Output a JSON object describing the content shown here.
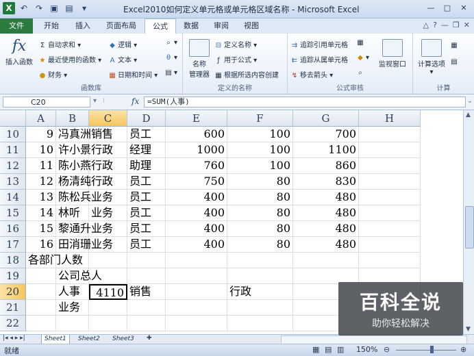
{
  "window": {
    "title": "Excel2010如何定义单元格或单元格区域名称 - Microsoft Excel",
    "app_logo": "X",
    "controls": [
      "—",
      "□",
      "✕"
    ]
  },
  "tabs": [
    {
      "label": "文件"
    },
    {
      "label": "开始"
    },
    {
      "label": "插入"
    },
    {
      "label": "页面布局"
    },
    {
      "label": "公式"
    },
    {
      "label": "数据"
    },
    {
      "label": "审阅"
    },
    {
      "label": "视图"
    }
  ],
  "ribbon": {
    "function_library": {
      "insert_function": "插入函数",
      "autosum": "自动求和",
      "recent": "最近使用的函数",
      "financial": "财务",
      "logical": "逻辑",
      "text": "文本",
      "datetime": "日期和时间",
      "label": "函数库"
    },
    "defined_names": {
      "name_manager_1": "名称",
      "name_manager_2": "管理器",
      "define_name": "定义名称",
      "use_in_formula": "用于公式",
      "create_from_selection": "根据所选内容创建",
      "label": "定义的名称"
    },
    "formula_auditing": {
      "trace_precedents": "追踪引用单元格",
      "trace_dependents": "追踪从属单元格",
      "remove_arrows": "移去箭头",
      "watch_window": "监视窗口",
      "label": "公式审核"
    },
    "calculation": {
      "calc_options": "计算选项",
      "label": "计算"
    }
  },
  "formula_bar": {
    "name_box": "C20",
    "fx": "fx",
    "formula": "=SUM(人事)"
  },
  "columns": [
    "A",
    "B",
    "C",
    "D",
    "E",
    "F",
    "G",
    "H"
  ],
  "rows": [
    {
      "num": "10",
      "cells": [
        "9",
        "冯真洲",
        "销售",
        "员工",
        "600",
        "100",
        "700",
        ""
      ]
    },
    {
      "num": "11",
      "cells": [
        "10",
        "许小景",
        "行政",
        "经理",
        "1000",
        "100",
        "1100",
        ""
      ]
    },
    {
      "num": "12",
      "cells": [
        "11",
        "陈小燕",
        "行政",
        "助理",
        "760",
        "100",
        "860",
        ""
      ]
    },
    {
      "num": "13",
      "cells": [
        "12",
        "杨清纯",
        "行政",
        "员工",
        "750",
        "80",
        "830",
        ""
      ]
    },
    {
      "num": "14",
      "cells": [
        "13",
        "陈松兵",
        "业务",
        "员工",
        "400",
        "80",
        "480",
        ""
      ]
    },
    {
      "num": "15",
      "cells": [
        "14",
        "林听",
        "业务",
        "员工",
        "400",
        "80",
        "480",
        ""
      ]
    },
    {
      "num": "16",
      "cells": [
        "15",
        "黎通升",
        "业务",
        "员工",
        "400",
        "80",
        "480",
        ""
      ]
    },
    {
      "num": "17",
      "cells": [
        "16",
        "田消珊",
        "业务",
        "员工",
        "400",
        "80",
        "480",
        ""
      ]
    },
    {
      "num": "18",
      "cells": [
        "各部门人数",
        "",
        "",
        "",
        "",
        "",
        "",
        ""
      ]
    },
    {
      "num": "19",
      "cells": [
        "",
        "公司总人",
        "",
        "",
        "",
        "",
        "",
        ""
      ]
    },
    {
      "num": "20",
      "cells": [
        "",
        "人事",
        "4110",
        "销售",
        "",
        "行政",
        "",
        ""
      ]
    },
    {
      "num": "21",
      "cells": [
        "",
        "业务",
        "",
        "",
        "",
        "",
        "",
        ""
      ]
    },
    {
      "num": "22",
      "cells": [
        "",
        "",
        "",
        "",
        "",
        "",
        "",
        ""
      ]
    }
  ],
  "sheets": [
    "Sheet1",
    "Sheet2",
    "Sheet3"
  ],
  "status": {
    "ready": "就绪",
    "zoom": "150%"
  },
  "watermark": {
    "title": "百科全说",
    "subtitle": "助你轻松解决"
  }
}
